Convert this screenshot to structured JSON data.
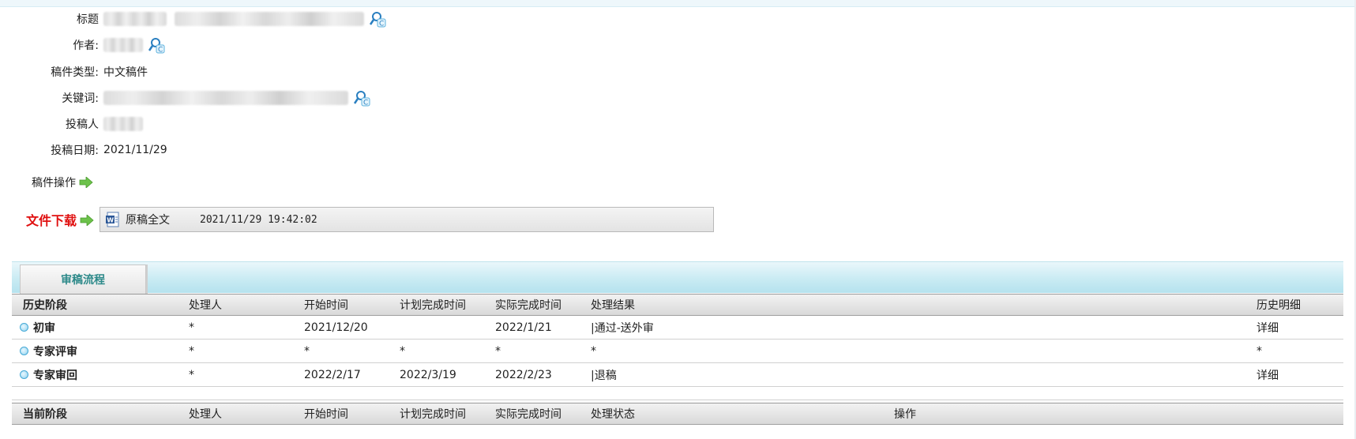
{
  "info": {
    "title_label": "标题",
    "author_label": "作者:",
    "type_label": "稿件类型:",
    "type_value": "中文稿件",
    "keywords_label": "关键词:",
    "submitter_label": "投稿人",
    "date_label": "投稿日期:",
    "date_value": "2021/11/29"
  },
  "ops": {
    "label": "稿件操作"
  },
  "download": {
    "label": "文件下载",
    "file_name": "原稿全文",
    "file_time": "2021/11/29 19:42:02"
  },
  "review": {
    "tab_label": "审稿流程",
    "history_headers": [
      "历史阶段",
      "处理人",
      "开始时间",
      "计划完成时间",
      "实际完成时间",
      "处理结果",
      "历史明细"
    ],
    "history_rows": [
      {
        "stage": "初审",
        "handler": "*",
        "start": "2021/12/20",
        "planned": "",
        "actual": "2022/1/21",
        "result": "|通过-送外审",
        "detail": "详细"
      },
      {
        "stage": "专家评审",
        "handler": "*",
        "start": "*",
        "planned": "*",
        "actual": "*",
        "result": "*",
        "detail": "*"
      },
      {
        "stage": "专家审回",
        "handler": "*",
        "start": "2022/2/17",
        "planned": "2022/3/19",
        "actual": "2022/2/23",
        "result": "|退稿",
        "detail": "详细"
      }
    ],
    "current_headers": [
      "当前阶段",
      "处理人",
      "开始时间",
      "计划完成时间",
      "实际完成时间",
      "处理状态",
      "操作"
    ]
  },
  "colors": {
    "download_label": "#e01010",
    "tab_text": "#2e8a8a",
    "bar_accent": "#b5e2ee"
  }
}
